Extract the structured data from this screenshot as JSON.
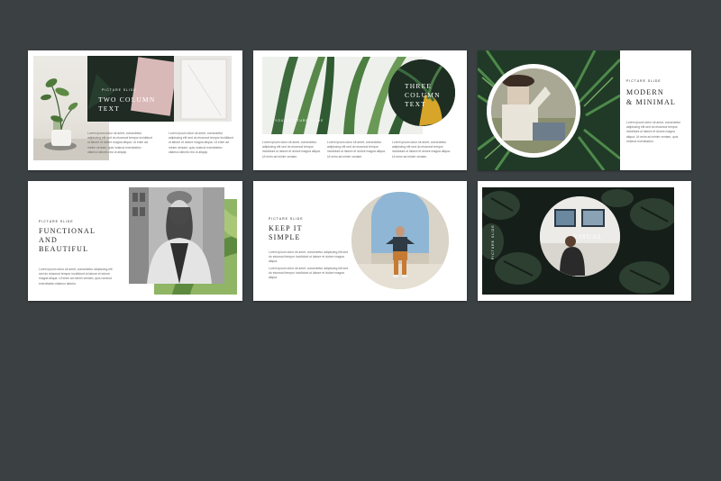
{
  "colors": {
    "background": "#3b4043",
    "slide": "#ffffff",
    "dark_green": "#1f2a22",
    "leaf_green": "#3f6b45",
    "blush": "#d9b9b8",
    "mustard": "#d7a52a",
    "text_dark": "#222222",
    "text_grey": "#6a6a6a"
  },
  "slides": [
    {
      "id": "two-column",
      "kicker": "PICTURE SLIDE",
      "title": "TWO COLUMN\nTEXT",
      "col1": "Lorem ipsum dolor sit amet, consectetur adipiscing elit sed do eiusmod tempor incididunt ut labore et dolore magna aliqua. Ut enim ad minim veniam, quis nostrud exercitation ullamco laboris nisi ut aliquip.",
      "col2": "Lorem ipsum dolor sit amet, consectetur adipiscing elit sed do eiusmod tempor incididunt ut labore et dolore magna aliqua. Ut enim ad minim veniam, quis nostrud exercitation ullamco laboris nisi ut aliquip."
    },
    {
      "id": "three-column",
      "kicker": "YOUR PICTURE SLIDE",
      "title": "THREE\nCOLUMN\nTEXT",
      "col1": "Lorem ipsum dolor sit amet, consectetur adipiscing elit sed do eiusmod tempor incididunt ut labore et dolore magna aliqua. Ut enim ad minim veniam.",
      "col2": "Lorem ipsum dolor sit amet, consectetur adipiscing elit sed do eiusmod tempor incididunt ut labore et dolore magna aliqua. Ut enim ad minim veniam.",
      "col3": "Lorem ipsum dolor sit amet, consectetur adipiscing elit sed do eiusmod tempor incididunt ut labore et dolore magna aliqua. Ut enim ad minim veniam."
    },
    {
      "id": "modern-minimal",
      "kicker": "PICTURE SLIDE",
      "title": "MODERN\n& MINIMAL",
      "body": "Lorem ipsum dolor sit amet, consectetur adipiscing elit sed do eiusmod tempor incididunt ut labore et dolore magna aliqua. Ut enim ad minim veniam, quis nostrud exercitation."
    },
    {
      "id": "functional",
      "kicker": "PICTURE SLIDE",
      "title": "FUNCTIONAL\nAND\nBEAUTIFUL",
      "body": "Lorem ipsum dolor sit amet, consectetur adipiscing elit sed do eiusmod tempor incididunt ut labore et dolore magna aliqua. Ut enim ad minim veniam, quis nostrud exercitation ullamco laboris."
    },
    {
      "id": "keep-it-simple",
      "kicker": "PICTURE SLIDE",
      "title": "KEEP IT\nSIMPLE",
      "col1": "Lorem ipsum dolor sit amet, consectetur adipiscing elit sed do eiusmod tempor incididunt ut labore et dolore magna aliqua.",
      "col2": "Lorem ipsum dolor sit amet, consectetur adipiscing elit sed do eiusmod tempor incididunt ut labore et dolore magna aliqua."
    },
    {
      "id": "visual",
      "kicker": "PICTURE SLIDE",
      "title": "VISUAL"
    }
  ]
}
